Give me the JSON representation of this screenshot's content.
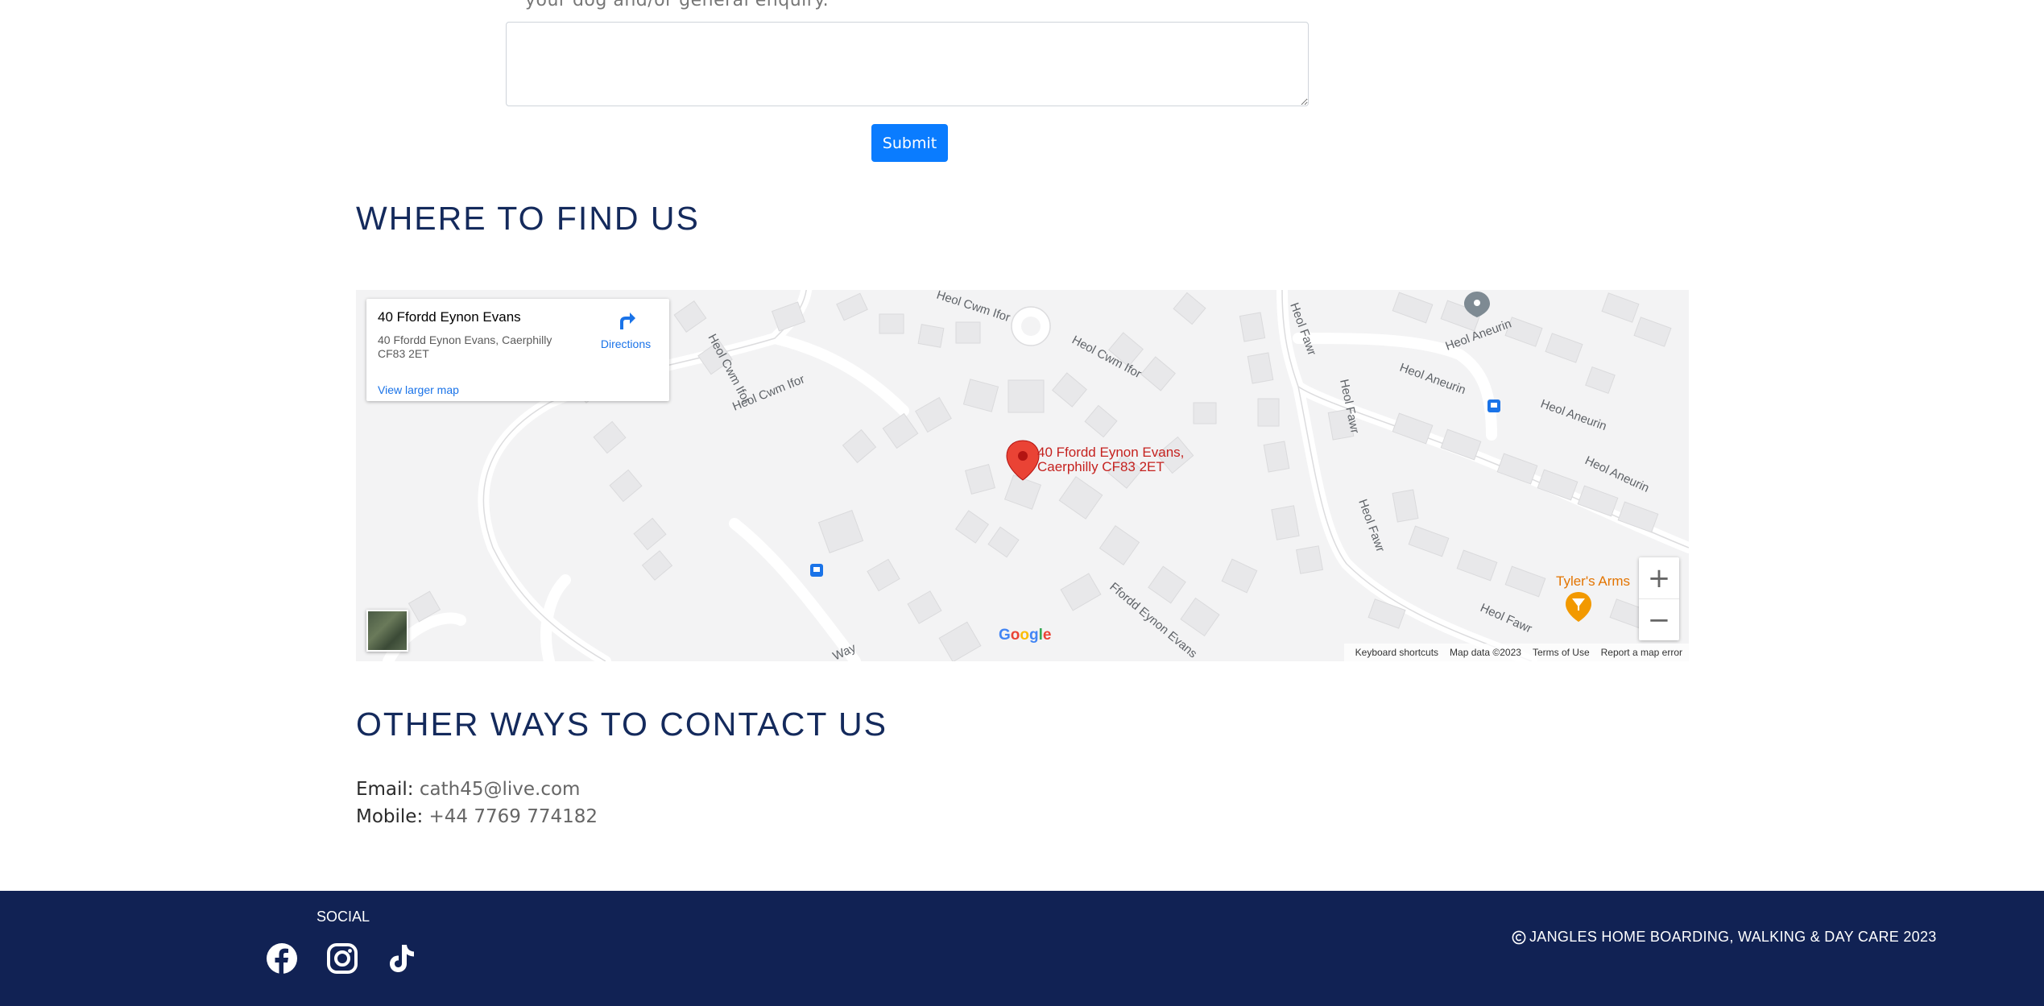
{
  "form": {
    "partial_line": "your dog and/or general enquiry.",
    "message_value": "",
    "submit_label": "Submit"
  },
  "find_us": {
    "heading": "WHERE TO FIND US",
    "map": {
      "card_title": "40 Ffordd Eynon Evans",
      "card_address": "40 Ffordd Eynon Evans, Caerphilly CF83 2ET",
      "directions_label": "Directions",
      "view_larger": "View larger map",
      "pin_label_line1": "40 Ffordd Eynon Evans,",
      "pin_label_line2": "Caerphilly CF83 2ET",
      "poi_label": "Tyler's Arms",
      "streets": [
        "Heol Cwm Ifor",
        "Heol Cwm Ifor",
        "Heol Cwm Ifor",
        "Heol Cwm Ifor",
        "Heol Aneurin",
        "Heol Aneurin",
        "Heol Aneurin",
        "Heol Aneurin",
        "Heol Fawr",
        "Heol Fawr",
        "Heol Fawr",
        "Heol Fawr",
        "Ffordd Eynon Evans",
        "Way"
      ],
      "zoom_in": "+",
      "zoom_out": "−",
      "google_logo": "Google",
      "attribution": [
        "Keyboard shortcuts",
        "Map data ©2023",
        "Terms of Use",
        "Report a map error"
      ]
    }
  },
  "contact": {
    "heading": "OTHER WAYS TO CONTACT US",
    "email_label": "Email:",
    "email_value": "cath45@live.com",
    "mobile_label": "Mobile:",
    "mobile_value": "+44 7769 774182"
  },
  "footer": {
    "social_heading": "SOCIAL",
    "icons": [
      "facebook-icon",
      "instagram-icon",
      "tiktok-icon"
    ],
    "copyright": "JANGLES HOME BOARDING, WALKING & DAY CARE 2023"
  },
  "colors": {
    "navy": "#112254",
    "heading": "#142a5c",
    "button": "#0a7cff",
    "map_link": "#1a73e8",
    "pin": "#ea4335"
  }
}
